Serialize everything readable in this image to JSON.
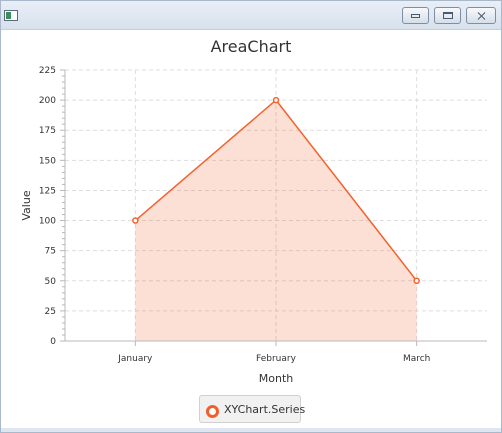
{
  "window": {
    "title": ""
  },
  "chart_data": {
    "type": "area",
    "title": "AreaChart",
    "xlabel": "Month",
    "ylabel": "Value",
    "categories": [
      "January",
      "February",
      "March"
    ],
    "series": [
      {
        "name": "XYChart.Series",
        "values": [
          100,
          200,
          50
        ]
      }
    ],
    "ylim": [
      0,
      225
    ],
    "yticks": [
      0,
      25,
      50,
      75,
      100,
      125,
      150,
      175,
      200,
      225
    ],
    "y_minor_per_major": 5,
    "grid": true,
    "legend": "bottom-center",
    "colors": {
      "line": "#f3622d",
      "fill": "#f3622d",
      "grid": "#dddddd",
      "axis": "#b8b8b8"
    }
  }
}
